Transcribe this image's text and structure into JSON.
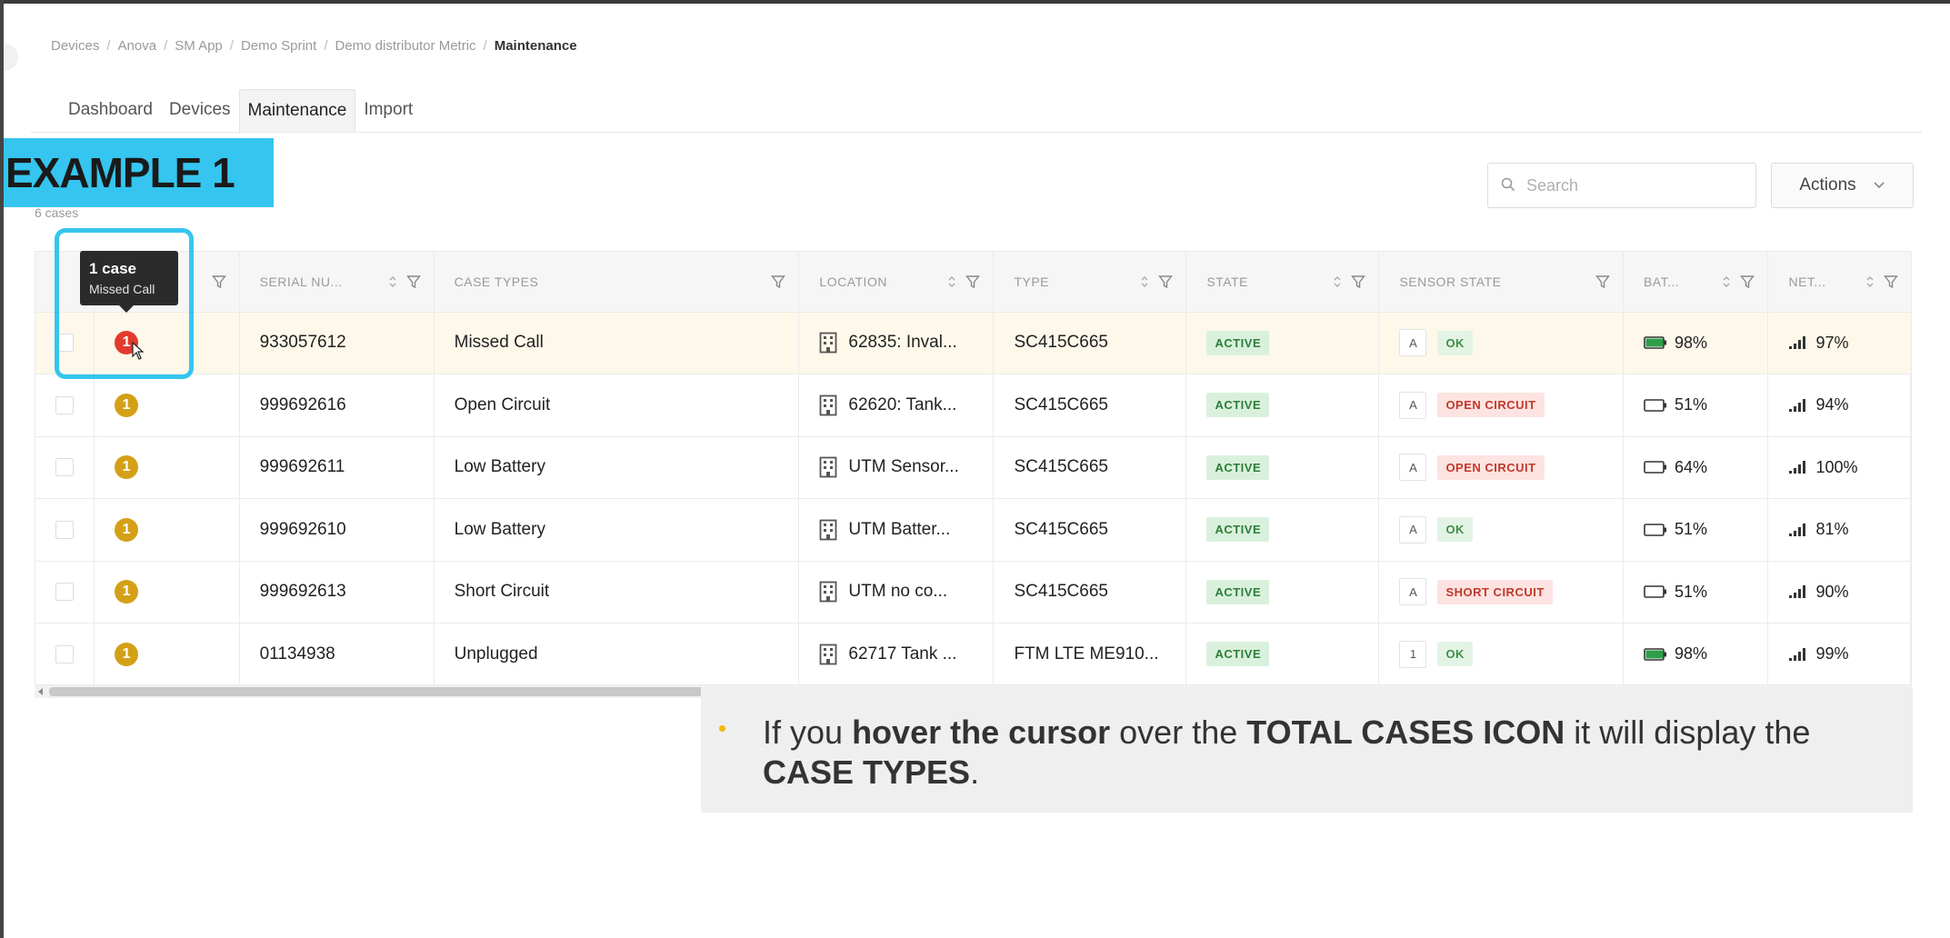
{
  "breadcrumb": [
    "Devices",
    "Anova",
    "SM App",
    "Demo Sprint",
    "Demo distributor Metric",
    "Maintenance"
  ],
  "tabs": [
    {
      "label": "Dashboard",
      "active": false
    },
    {
      "label": "Devices",
      "active": false
    },
    {
      "label": "Maintenance",
      "active": true
    },
    {
      "label": "Import",
      "active": false
    }
  ],
  "example_label": "EXAMPLE 1",
  "cases_count": "6 cases",
  "search": {
    "placeholder": "Search",
    "value": ""
  },
  "actions": {
    "label": "Actions"
  },
  "table": {
    "columns": [
      "SERIAL NU...",
      "CASE TYPES",
      "LOCATION",
      "TYPE",
      "STATE",
      "SENSOR STATE",
      "BAT...",
      "NET..."
    ],
    "rows": [
      {
        "cases": "1",
        "case_color": "red",
        "serial": "933057612",
        "case_type": "Missed Call",
        "location": "62835: Inval...",
        "type": "SC415C665",
        "state": "ACTIVE",
        "sensor_chip": "A",
        "sensor_status": "OK",
        "sensor_ok": true,
        "battery": "98%",
        "battery_fill": 0.98,
        "network": "97%",
        "highlight": true
      },
      {
        "cases": "1",
        "case_color": "amber",
        "serial": "999692616",
        "case_type": "Open Circuit",
        "location": "62620: Tank...",
        "type": "SC415C665",
        "state": "ACTIVE",
        "sensor_chip": "A",
        "sensor_status": "OPEN CIRCUIT",
        "sensor_ok": false,
        "battery": "51%",
        "battery_fill": 0.0,
        "network": "94%",
        "highlight": false
      },
      {
        "cases": "1",
        "case_color": "amber",
        "serial": "999692611",
        "case_type": "Low Battery",
        "location": "UTM Sensor...",
        "type": "SC415C665",
        "state": "ACTIVE",
        "sensor_chip": "A",
        "sensor_status": "OPEN CIRCUIT",
        "sensor_ok": false,
        "battery": "64%",
        "battery_fill": 0.0,
        "network": "100%",
        "highlight": false
      },
      {
        "cases": "1",
        "case_color": "amber",
        "serial": "999692610",
        "case_type": "Low Battery",
        "location": "UTM Batter...",
        "type": "SC415C665",
        "state": "ACTIVE",
        "sensor_chip": "A",
        "sensor_status": "OK",
        "sensor_ok": true,
        "battery": "51%",
        "battery_fill": 0.0,
        "network": "81%",
        "highlight": false
      },
      {
        "cases": "1",
        "case_color": "amber",
        "serial": "999692613",
        "case_type": "Short Circuit",
        "location": "UTM no co...",
        "type": "SC415C665",
        "state": "ACTIVE",
        "sensor_chip": "A",
        "sensor_status": "SHORT CIRCUIT",
        "sensor_ok": false,
        "battery": "51%",
        "battery_fill": 0.0,
        "network": "90%",
        "highlight": false
      },
      {
        "cases": "1",
        "case_color": "amber",
        "serial": "01134938",
        "case_type": "Unplugged",
        "location": "62717 Tank ...",
        "type": "FTM LTE ME910...",
        "state": "ACTIVE",
        "sensor_chip": "1",
        "sensor_status": "OK",
        "sensor_ok": true,
        "battery": "98%",
        "battery_fill": 0.98,
        "network": "99%",
        "highlight": false
      }
    ]
  },
  "tooltip": {
    "title": "1 case",
    "subtitle": "Missed Call"
  },
  "note": {
    "parts": [
      {
        "text": "If you ",
        "bold": false
      },
      {
        "text": "hover the cursor",
        "bold": true
      },
      {
        "text": " over the ",
        "bold": false
      },
      {
        "text": "TOTAL CASES ICON",
        "bold": true
      },
      {
        "text": " it will display the ",
        "bold": false
      },
      {
        "text": "CASE TYPES",
        "bold": true
      },
      {
        "text": ".",
        "bold": false
      }
    ]
  },
  "colors": {
    "accent": "#35c5ef",
    "amber_case": "#d4a017",
    "red_case": "#e23b2e",
    "active_badge": "#d9f1dc",
    "bullet": "#f2b705"
  },
  "icons": [
    "search-icon",
    "chevron-down-icon",
    "filter-icon",
    "sort-icon",
    "building-icon",
    "battery-icon",
    "signal-icon",
    "cursor-icon"
  ]
}
